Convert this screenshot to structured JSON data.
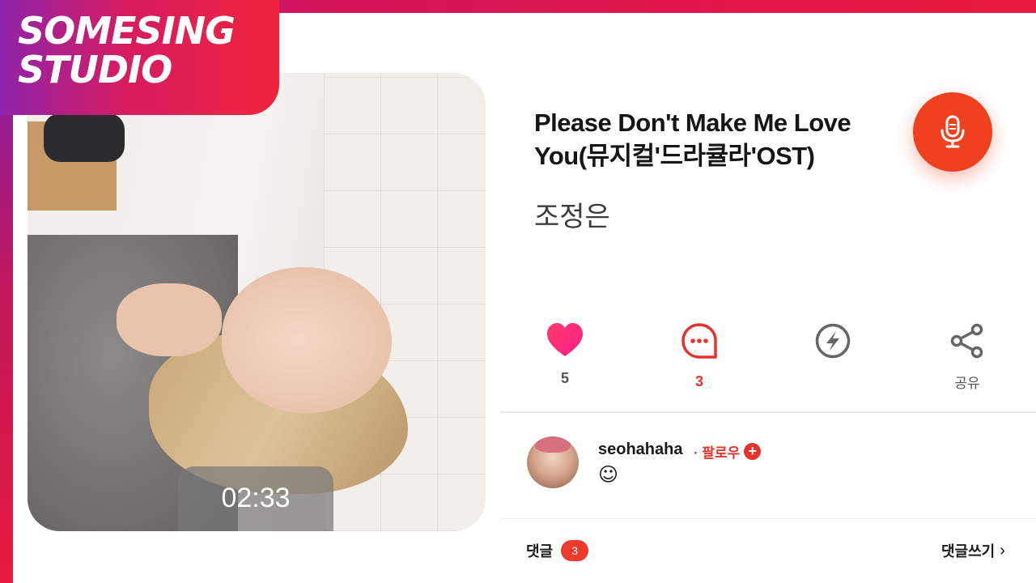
{
  "brand": {
    "line1": "SOMESING",
    "line2": "STUDIO"
  },
  "player": {
    "time": "02:33"
  },
  "song": {
    "title": "Please Don't Make Me Love You(뮤지컬'드라큘라'OST)",
    "artist": "조정은"
  },
  "actions": {
    "likes": "5",
    "comments": "3",
    "share_label": "공유"
  },
  "comment": {
    "username": "seohahaha",
    "follow_label": "· 팔로우",
    "follow_plus": "+",
    "text": "☺"
  },
  "footer": {
    "comments_label": "댓글",
    "comments_count": "3",
    "write_label": "댓글쓰기",
    "write_chevron": "›"
  },
  "colors": {
    "accent": "#f0401e",
    "like": "#ff2e5f",
    "comment": "#e8322b",
    "icon_gray": "#666666"
  }
}
